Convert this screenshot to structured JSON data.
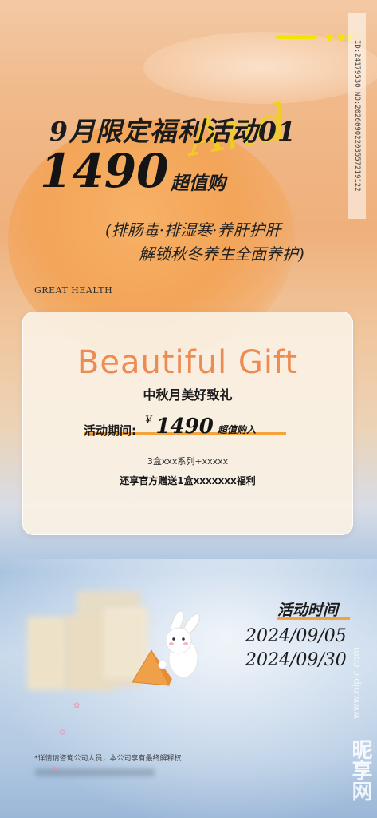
{
  "header": {
    "line1": "9月限定福利活动01",
    "price_big": "1490",
    "price_suffix": "超值购",
    "script_text": "And",
    "subline1": "(排肠毒·排湿寒·养肝护肝",
    "subline2": "解锁秋冬养生全面养护)",
    "tagline": "GREAT HEALTH"
  },
  "side_watermark": "ID:24179530 NO:20260902203557219122",
  "card": {
    "title": "Beautiful Gift",
    "subtitle": "中秋月美好致礼",
    "price_label": "活动期间:",
    "price_symbol": "¥",
    "price_value": "1490",
    "price_tail": "超值购入",
    "line3": "3盒xxx系列+xxxxx",
    "line4": "还享官方赠送1盒xxxxxxx福利"
  },
  "event": {
    "title": "活动时间",
    "date_start": "2024/09/05",
    "date_end": "2024/09/30"
  },
  "footer": {
    "note": "*详情请咨询公司人员，本公司享有最终解释权"
  },
  "watermark": {
    "site": "www.nipic.com",
    "logo": "昵享网"
  },
  "colors": {
    "accent_orange": "#f4a23b",
    "gift_title": "#ec8b52",
    "highlight_yellow": "#f5e400"
  }
}
